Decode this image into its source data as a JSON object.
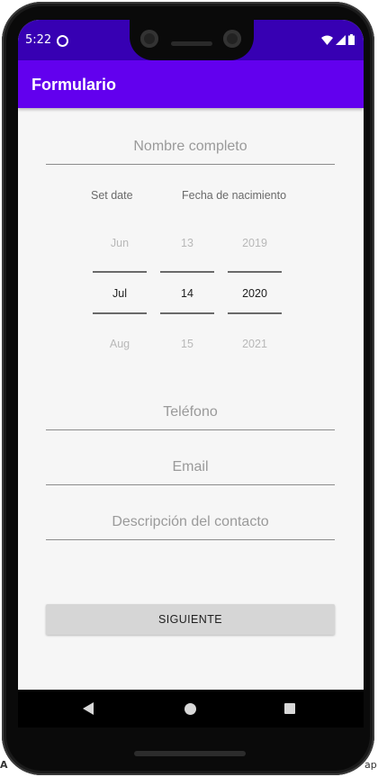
{
  "status_bar": {
    "time": "5:22",
    "icons": [
      "wifi-icon",
      "signal-icon",
      "battery-icon"
    ]
  },
  "app_bar": {
    "title": "Formulario"
  },
  "form": {
    "full_name_placeholder": "Nombre completo",
    "date_button_label": "Set date",
    "birth_date_label": "Fecha de nacimiento",
    "date_picker": {
      "month": {
        "prev": "Jun",
        "current": "Jul",
        "next": "Aug"
      },
      "day": {
        "prev": "13",
        "current": "14",
        "next": "15"
      },
      "year": {
        "prev": "2019",
        "current": "2020",
        "next": "2021"
      }
    },
    "phone_placeholder": "Teléfono",
    "email_placeholder": "Email",
    "description_placeholder": "Descripción del contacto",
    "next_button_label": "SIGUIENTE"
  },
  "background_text": {
    "left": "A",
    "right": "ap"
  },
  "colors": {
    "status_bar": "#3700b3",
    "app_bar": "#6200ee",
    "screen_background": "#f6f6f6",
    "button": "#d6d6d6"
  }
}
